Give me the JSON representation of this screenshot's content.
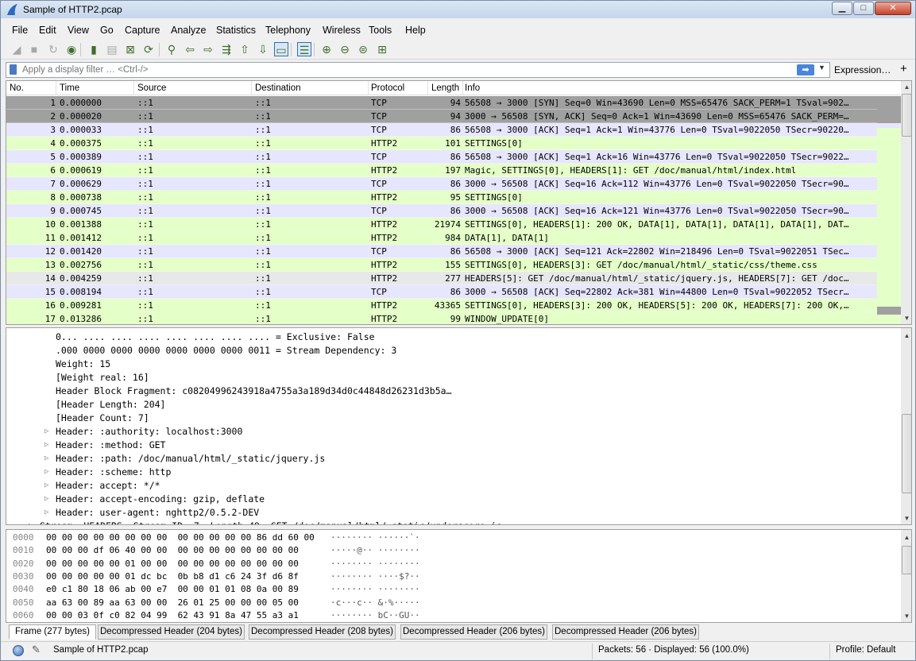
{
  "window": {
    "title": "Sample of HTTP2.pcap",
    "min_label": "▁",
    "max_label": "□",
    "close_label": "✕"
  },
  "menu": [
    "File",
    "Edit",
    "View",
    "Go",
    "Capture",
    "Analyze",
    "Statistics",
    "Telephony",
    "Wireless",
    "Tools",
    "Help"
  ],
  "toolbar_icons": [
    "shark-fin-start-icon",
    "stop-icon",
    "restart-icon",
    "capture-options-icon",
    "open-file-icon",
    "save-file-icon",
    "close-file-icon",
    "reload-icon",
    "find-packet-icon",
    "go-back-icon",
    "go-forward-icon",
    "go-to-packet-icon",
    "go-first-icon",
    "go-last-icon",
    "autoscroll-icon",
    "colorize-icon",
    "zoom-in-icon",
    "zoom-out-icon",
    "zoom-normal-icon",
    "resize-columns-icon"
  ],
  "filter": {
    "placeholder": "Apply a display filter … <Ctrl-/>",
    "expression_label": "Expression…",
    "plus_label": "+",
    "apply_label": "➡"
  },
  "columns": [
    "No.",
    "Time",
    "Source",
    "Destination",
    "Protocol",
    "Length",
    "Info"
  ],
  "packets": [
    {
      "no": "1",
      "time": "0.000000",
      "src": "::1",
      "dst": "::1",
      "proto": "TCP",
      "len": "94",
      "info": "56508 → 3000 [SYN] Seq=0 Win=43690 Len=0 MSS=65476 SACK_PERM=1 TSval=902…",
      "cls": "sel"
    },
    {
      "no": "2",
      "time": "0.000020",
      "src": "::1",
      "dst": "::1",
      "proto": "TCP",
      "len": "94",
      "info": "3000 → 56508 [SYN, ACK] Seq=0 Ack=1 Win=43690 Len=0 MSS=65476 SACK_PERM=…",
      "cls": "sel"
    },
    {
      "no": "3",
      "time": "0.000033",
      "src": "::1",
      "dst": "::1",
      "proto": "TCP",
      "len": "86",
      "info": "56508 → 3000 [ACK] Seq=1 Ack=1 Win=43776 Len=0 TSval=9022050 TSecr=90220…",
      "cls": "tcp"
    },
    {
      "no": "4",
      "time": "0.000375",
      "src": "::1",
      "dst": "::1",
      "proto": "HTTP2",
      "len": "101",
      "info": "SETTINGS[0]",
      "cls": "http2"
    },
    {
      "no": "5",
      "time": "0.000389",
      "src": "::1",
      "dst": "::1",
      "proto": "TCP",
      "len": "86",
      "info": "56508 → 3000 [ACK] Seq=1 Ack=16 Win=43776 Len=0 TSval=9022050 TSecr=9022…",
      "cls": "tcp"
    },
    {
      "no": "6",
      "time": "0.000619",
      "src": "::1",
      "dst": "::1",
      "proto": "HTTP2",
      "len": "197",
      "info": "Magic, SETTINGS[0], HEADERS[1]: GET /doc/manual/html/index.html",
      "cls": "http2"
    },
    {
      "no": "7",
      "time": "0.000629",
      "src": "::1",
      "dst": "::1",
      "proto": "TCP",
      "len": "86",
      "info": "3000 → 56508 [ACK] Seq=16 Ack=112 Win=43776 Len=0 TSval=9022050 TSecr=90…",
      "cls": "tcp"
    },
    {
      "no": "8",
      "time": "0.000738",
      "src": "::1",
      "dst": "::1",
      "proto": "HTTP2",
      "len": "95",
      "info": "SETTINGS[0]",
      "cls": "http2"
    },
    {
      "no": "9",
      "time": "0.000745",
      "src": "::1",
      "dst": "::1",
      "proto": "TCP",
      "len": "86",
      "info": "3000 → 56508 [ACK] Seq=16 Ack=121 Win=43776 Len=0 TSval=9022050 TSecr=90…",
      "cls": "tcp"
    },
    {
      "no": "10",
      "time": "0.001388",
      "src": "::1",
      "dst": "::1",
      "proto": "HTTP2",
      "len": "21974",
      "info": "SETTINGS[0], HEADERS[1]: 200 OK, DATA[1], DATA[1], DATA[1], DATA[1], DAT…",
      "cls": "http2"
    },
    {
      "no": "11",
      "time": "0.001412",
      "src": "::1",
      "dst": "::1",
      "proto": "HTTP2",
      "len": "984",
      "info": "DATA[1], DATA[1]",
      "cls": "http2"
    },
    {
      "no": "12",
      "time": "0.001420",
      "src": "::1",
      "dst": "::1",
      "proto": "TCP",
      "len": "86",
      "info": "56508 → 3000 [ACK] Seq=121 Ack=22802 Win=218496 Len=0 TSval=9022051 TSec…",
      "cls": "tcp"
    },
    {
      "no": "13",
      "time": "0.002756",
      "src": "::1",
      "dst": "::1",
      "proto": "HTTP2",
      "len": "155",
      "info": "SETTINGS[0], HEADERS[3]: GET /doc/manual/html/_static/css/theme.css",
      "cls": "http2"
    },
    {
      "no": "14",
      "time": "0.004259",
      "src": "::1",
      "dst": "::1",
      "proto": "HTTP2",
      "len": "277",
      "info": "HEADERS[5]: GET /doc/manual/html/_static/jquery.js, HEADERS[7]: GET /doc…",
      "cls": "hover"
    },
    {
      "no": "15",
      "time": "0.008194",
      "src": "::1",
      "dst": "::1",
      "proto": "TCP",
      "len": "86",
      "info": "3000 → 56508 [ACK] Seq=22802 Ack=381 Win=44800 Len=0 TSval=9022052 TSecr…",
      "cls": "tcp"
    },
    {
      "no": "16",
      "time": "0.009281",
      "src": "::1",
      "dst": "::1",
      "proto": "HTTP2",
      "len": "43365",
      "info": "SETTINGS[0], HEADERS[3]: 200 OK, HEADERS[5]: 200 OK, HEADERS[7]: 200 OK,…",
      "cls": "http2"
    },
    {
      "no": "17",
      "time": "0.013286",
      "src": "::1",
      "dst": "::1",
      "proto": "HTTP2",
      "len": "99",
      "info": "WINDOW_UPDATE[0]",
      "cls": "http2"
    }
  ],
  "details": [
    {
      "text": "0... .... .... .... .... .... .... .... = Exclusive: False",
      "indent": 62,
      "arrow": false
    },
    {
      "text": ".000 0000 0000 0000 0000 0000 0000 0011 = Stream Dependency: 3",
      "indent": 62,
      "arrow": false
    },
    {
      "text": "Weight: 15",
      "indent": 62,
      "arrow": false
    },
    {
      "text": "[Weight real: 16]",
      "indent": 62,
      "arrow": false
    },
    {
      "text": "Header Block Fragment: c08204996243918a4755a3a189d34d0c44848d26231d3b5a…",
      "indent": 62,
      "arrow": false
    },
    {
      "text": "[Header Length: 204]",
      "indent": 62,
      "arrow": false
    },
    {
      "text": "[Header Count: 7]",
      "indent": 62,
      "arrow": false
    },
    {
      "text": "Header: :authority: localhost:3000",
      "indent": 62,
      "arrow": true
    },
    {
      "text": "Header: :method: GET",
      "indent": 62,
      "arrow": true
    },
    {
      "text": "Header: :path: /doc/manual/html/_static/jquery.js",
      "indent": 62,
      "arrow": true
    },
    {
      "text": "Header: :scheme: http",
      "indent": 62,
      "arrow": true
    },
    {
      "text": "Header: accept: */*",
      "indent": 62,
      "arrow": true
    },
    {
      "text": "Header: accept-encoding: gzip, deflate",
      "indent": 62,
      "arrow": true
    },
    {
      "text": "Header: user-agent: nghttp2/0.5.2-DEV",
      "indent": 62,
      "arrow": true
    },
    {
      "text": "Stream: HEADERS, Stream ID: 7, Length 49, GET /doc/manual/html/_static/underscore.js",
      "indent": 42,
      "arrow": true
    }
  ],
  "bytes": [
    {
      "off": "0000",
      "hex": "00 00 00 00 00 00 00 00  00 00 00 00 00 86 dd 60 00",
      "asc": "········ ······`·"
    },
    {
      "off": "0010",
      "hex": "00 00 00 df 06 40 00 00  00 00 00 00 00 00 00 00",
      "asc": "·····@·· ········"
    },
    {
      "off": "0020",
      "hex": "00 00 00 00 00 01 00 00  00 00 00 00 00 00 00 00",
      "asc": "········ ········"
    },
    {
      "off": "0030",
      "hex": "00 00 00 00 00 01 dc bc  0b b8 d1 c6 24 3f d6 8f",
      "asc": "········ ····$?··"
    },
    {
      "off": "0040",
      "hex": "e0 c1 80 18 06 ab 00 e7  00 00 01 01 08 0a 00 89",
      "asc": "········ ········"
    },
    {
      "off": "0050",
      "hex": "aa 63 00 89 aa 63 00 00  26 01 25 00 00 00 05 00",
      "asc": "·c···c·· &·%·····"
    },
    {
      "off": "0060",
      "hex": "00 00 03 0f c0 82 04 99  62 43 91 8a 47 55 a3 a1",
      "asc": "········ bC··GU··"
    }
  ],
  "tabs": [
    "Frame (277 bytes)",
    "Decompressed Header (204 bytes)",
    "Decompressed Header (208 bytes)",
    "Decompressed Header (206 bytes)",
    "Decompressed Header (206 bytes)"
  ],
  "status": {
    "file": "Sample of HTTP2.pcap",
    "packets": "Packets: 56 · Displayed: 56 (100.0%)",
    "profile": "Profile: Default"
  }
}
